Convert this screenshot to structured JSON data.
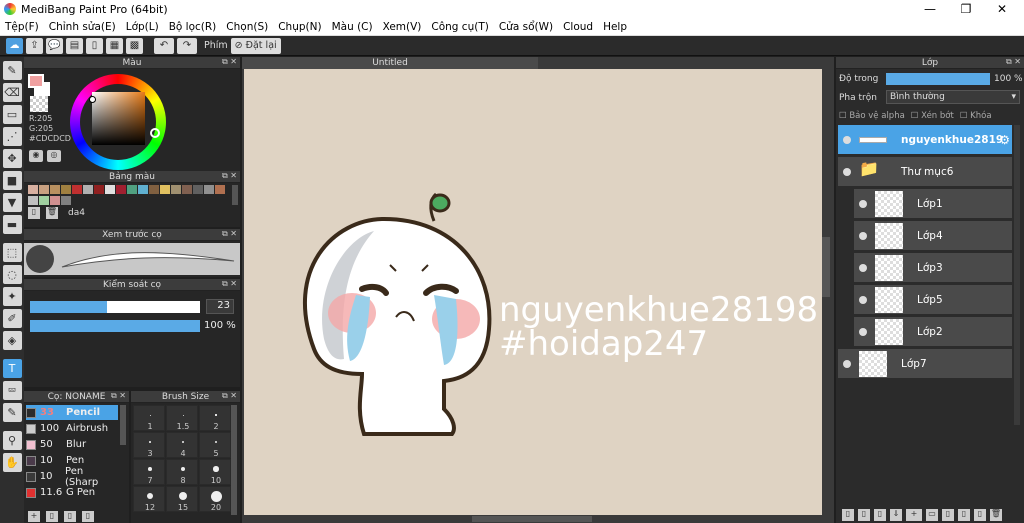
{
  "window": {
    "title": "MediBang Paint Pro (64bit)",
    "min": "—",
    "max": "❐",
    "close": "✕"
  },
  "menu": [
    "Tệp(F)",
    "Chỉnh sửa(E)",
    "Lớp(L)",
    "Bộ lọc(R)",
    "Chọn(S)",
    "Chụp(N)",
    "Màu (C)",
    "Xem(V)",
    "Công cụ(T)",
    "Cửa sổ(W)",
    "Cloud",
    "Help"
  ],
  "toolbar": {
    "key_label": "Phím",
    "reset_label": "Đặt lại"
  },
  "color_panel": {
    "title": "Màu",
    "rgb_r": "R:205",
    "rgb_g": "G:205",
    "hex": "#CDCDCD",
    "fg_color": "#f0a0a0",
    "bg_color": "#ffffff"
  },
  "palette_panel": {
    "title": "Bảng màu",
    "name": "da4",
    "swatches": [
      "#d8b0a0",
      "#c8a080",
      "#b89060",
      "#a08040",
      "#c03030",
      "#b0b0b0",
      "#902020",
      "#e0e0e0",
      "#a02030",
      "#50a080",
      "#60b0d0",
      "#806040",
      "#e0c060",
      "#a09070",
      "#806050",
      "#606060",
      "#909090",
      "#b07050",
      "#c0c0c0",
      "#a0d0a0",
      "#d09090",
      "#808080"
    ]
  },
  "preview_panel": {
    "title": "Xem trước cọ"
  },
  "control_panel": {
    "title": "Kiểm soát cọ",
    "size_value": "23",
    "opacity_value": "100 %",
    "size_fraction": 0.45,
    "opacity_fraction": 1.0
  },
  "brush_panel": {
    "title": "Cọ: NONAME",
    "brushes": [
      {
        "size": "33",
        "name": "Pencil",
        "color": "#2b2b2b",
        "selected": true
      },
      {
        "size": "100",
        "name": "Airbrush",
        "color": "#cccccc",
        "selected": false
      },
      {
        "size": "50",
        "name": "Blur",
        "color": "#f0c0d0",
        "selected": false
      },
      {
        "size": "10",
        "name": "Pen",
        "color": "#4a3a4a",
        "selected": false
      },
      {
        "size": "10",
        "name": "Pen (Sharp",
        "color": "#3a3a3a",
        "selected": false
      },
      {
        "size": "11.6",
        "name": "G Pen",
        "color": "#e03030",
        "selected": false
      }
    ]
  },
  "size_panel": {
    "title": "Brush Size",
    "sizes": [
      "1",
      "1.5",
      "2",
      "3",
      "4",
      "5",
      "7",
      "8",
      "10",
      "12",
      "15",
      "20"
    ]
  },
  "canvas": {
    "tab_title": "Untitled",
    "text_line1": "nguyenkhue28198",
    "text_line2": "#hoidap247"
  },
  "layer_panel": {
    "title": "Lớp",
    "opacity_label": "Độ trong",
    "opacity_value": "100 %",
    "opacity_fraction": 1.0,
    "blend_label": "Pha trộn",
    "blend_value": "Bình thường",
    "protect_alpha": "Bảo vệ alpha",
    "clipping": "Xén bớt",
    "lock": "Khóa",
    "layers": [
      {
        "name": "nguyenkhue2819",
        "indent": 0,
        "selected": true,
        "type": "text"
      },
      {
        "name": "Thư mục6",
        "indent": 0,
        "selected": false,
        "type": "folder"
      },
      {
        "name": "Lớp1",
        "indent": 1,
        "selected": false,
        "type": "layer"
      },
      {
        "name": "Lớp4",
        "indent": 1,
        "selected": false,
        "type": "layer"
      },
      {
        "name": "Lớp3",
        "indent": 1,
        "selected": false,
        "type": "layer"
      },
      {
        "name": "Lớp5",
        "indent": 1,
        "selected": false,
        "type": "layer"
      },
      {
        "name": "Lớp2",
        "indent": 1,
        "selected": false,
        "type": "layer"
      },
      {
        "name": "Lớp7",
        "indent": 0,
        "selected": false,
        "type": "layer"
      }
    ]
  }
}
